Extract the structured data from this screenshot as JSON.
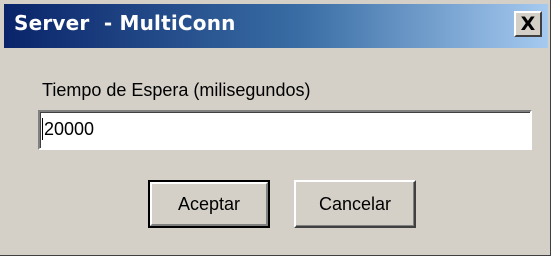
{
  "window": {
    "title": "Server  - MultiConn",
    "close_glyph": "X"
  },
  "prompt": {
    "label": "Tiempo de Espera (milisegundos)",
    "value": "20000"
  },
  "buttons": {
    "ok_label": "Aceptar",
    "cancel_label": "Cancelar"
  },
  "colors": {
    "titlebar_start": "#0a246a",
    "titlebar_end": "#a6caf0",
    "dialog_face": "#d4d0c8"
  }
}
